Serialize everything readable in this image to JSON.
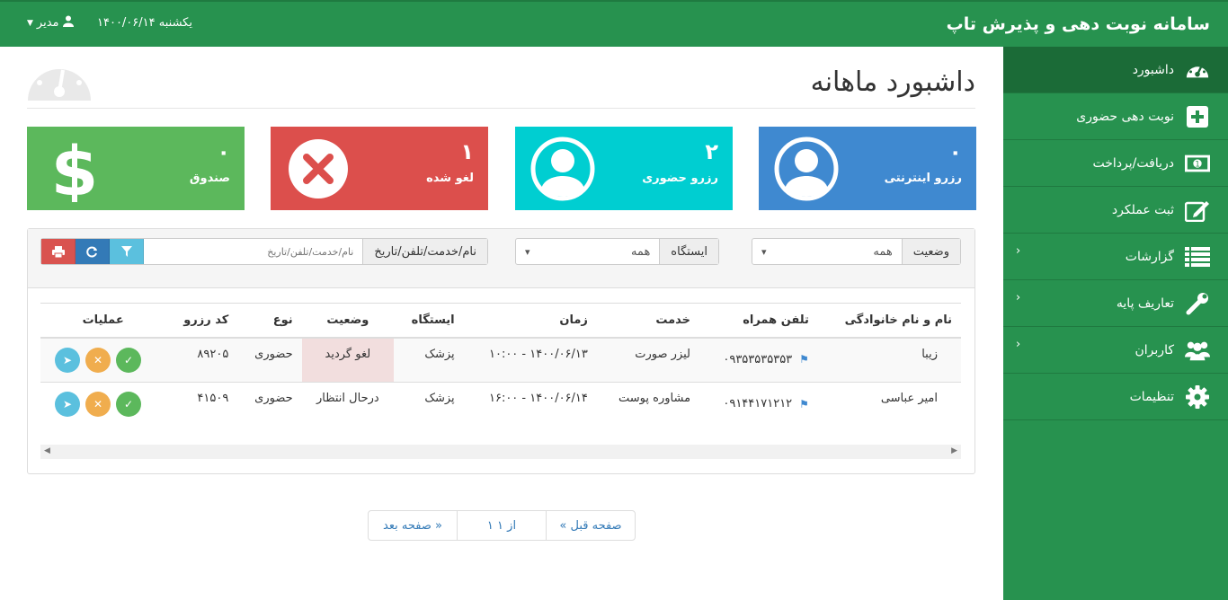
{
  "header": {
    "app_title": "سامانه نوبت دهی و پذیرش تاپ",
    "date": "یکشنبه ۱۴۰۰/۰۶/۱۴",
    "user": "مدیر"
  },
  "sidebar": {
    "items": [
      {
        "label": "داشبورد",
        "icon": "dashboard-icon",
        "active": true,
        "has_submenu": false
      },
      {
        "label": "نوبت دهی حضوری",
        "icon": "plus-square-icon",
        "active": false,
        "has_submenu": false
      },
      {
        "label": "دریافت/پرداخت",
        "icon": "money-icon",
        "active": false,
        "has_submenu": false
      },
      {
        "label": "ثبت عملکرد",
        "icon": "edit-icon",
        "active": false,
        "has_submenu": false
      },
      {
        "label": "گزارشات",
        "icon": "list-icon",
        "active": false,
        "has_submenu": true
      },
      {
        "label": "تعاریف پایه",
        "icon": "wrench-icon",
        "active": false,
        "has_submenu": true
      },
      {
        "label": "کاربران",
        "icon": "users-icon",
        "active": false,
        "has_submenu": true
      },
      {
        "label": "تنظیمات",
        "icon": "gear-icon",
        "active": false,
        "has_submenu": false
      }
    ]
  },
  "page": {
    "title": "داشبورد ماهانه"
  },
  "cards": {
    "online": {
      "value": "۰",
      "label": "رزرو اینترنتی",
      "color": "#3f89d0"
    },
    "inperson": {
      "value": "۲",
      "label": "رزرو حضوری",
      "color": "#00ced1"
    },
    "cancel": {
      "value": "۱",
      "label": "لغو شده",
      "color": "#dc4f4c"
    },
    "fund": {
      "value": "۰",
      "label": "صندوق",
      "color": "#5cb85c"
    }
  },
  "filters": {
    "status_label": "وضعیت",
    "status_value": "همه",
    "station_label": "ایستگاه",
    "station_value": "همه",
    "search_label": "نام/خدمت/تلفن/تاریخ",
    "search_placeholder": "نام/خدمت/تلفن/تاریخ"
  },
  "table": {
    "headers": [
      "نام و نام خانوادگی",
      "تلفن همراه",
      "خدمت",
      "زمان",
      "ایستگاه",
      "وضعیت",
      "نوع",
      "کد رزرو",
      "عملیات"
    ],
    "rows": [
      {
        "name": "زیبا",
        "phone": "۰۹۳۵۳۵۳۵۳۵۳",
        "service": "لیزر صورت",
        "time": "۱۴۰۰/۰۶/۱۳ - ۱۰:۰۰",
        "station": "پزشک",
        "status": "لغو گردید",
        "type": "حضوری",
        "code": "۸۹۲۰۵"
      },
      {
        "name": "امیر عباسی",
        "phone": "۰۹۱۴۴۱۷۱۲۱۲",
        "service": "مشاوره پوست",
        "time": "۱۴۰۰/۰۶/۱۴ - ۱۶:۰۰",
        "station": "پزشک",
        "status": "درحال انتظار",
        "type": "حضوری",
        "code": "۴۱۵۰۹"
      }
    ]
  },
  "pager": {
    "prev": "« صفحه قبل",
    "info": "۱ از ۱",
    "next": "صفحه بعد »"
  }
}
